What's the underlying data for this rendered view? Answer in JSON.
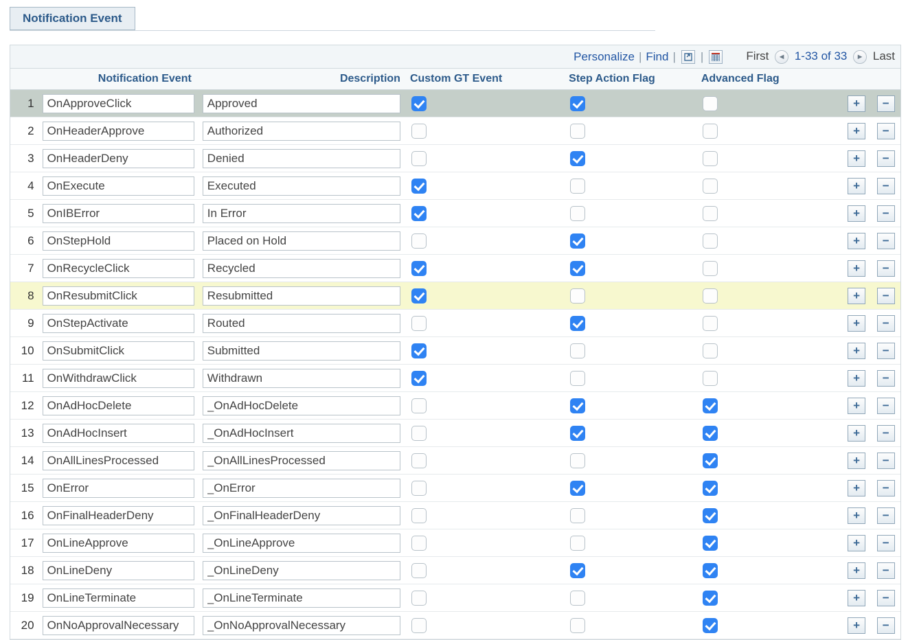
{
  "tab": {
    "label": "Notification Event"
  },
  "toolbar": {
    "personalize": "Personalize",
    "find": "Find",
    "first": "First",
    "last": "Last",
    "range": "1-33 of 33"
  },
  "columns": {
    "event": "Notification Event",
    "description": "Description",
    "custom_gt": "Custom GT Event",
    "step_action": "Step Action Flag",
    "advanced": "Advanced Flag"
  },
  "rows": [
    {
      "n": 1,
      "event": "OnApproveClick",
      "desc": "Approved",
      "cgt": true,
      "saf": true,
      "adv": false,
      "selected": true
    },
    {
      "n": 2,
      "event": "OnHeaderApprove",
      "desc": "Authorized",
      "cgt": false,
      "saf": false,
      "adv": false
    },
    {
      "n": 3,
      "event": "OnHeaderDeny",
      "desc": "Denied",
      "cgt": false,
      "saf": true,
      "adv": false
    },
    {
      "n": 4,
      "event": "OnExecute",
      "desc": "Executed",
      "cgt": true,
      "saf": false,
      "adv": false
    },
    {
      "n": 5,
      "event": "OnIBError",
      "desc": "In Error",
      "cgt": true,
      "saf": false,
      "adv": false
    },
    {
      "n": 6,
      "event": "OnStepHold",
      "desc": "Placed on Hold",
      "cgt": false,
      "saf": true,
      "adv": false
    },
    {
      "n": 7,
      "event": "OnRecycleClick",
      "desc": "Recycled",
      "cgt": true,
      "saf": true,
      "adv": false
    },
    {
      "n": 8,
      "event": "OnResubmitClick",
      "desc": "Resubmitted",
      "cgt": true,
      "saf": false,
      "adv": false,
      "highlight": true
    },
    {
      "n": 9,
      "event": "OnStepActivate",
      "desc": "Routed",
      "cgt": false,
      "saf": true,
      "adv": false
    },
    {
      "n": 10,
      "event": "OnSubmitClick",
      "desc": "Submitted",
      "cgt": true,
      "saf": false,
      "adv": false
    },
    {
      "n": 11,
      "event": "OnWithdrawClick",
      "desc": "Withdrawn",
      "cgt": true,
      "saf": false,
      "adv": false
    },
    {
      "n": 12,
      "event": "OnAdHocDelete",
      "desc": "_OnAdHocDelete",
      "cgt": false,
      "saf": true,
      "adv": true
    },
    {
      "n": 13,
      "event": "OnAdHocInsert",
      "desc": "_OnAdHocInsert",
      "cgt": false,
      "saf": true,
      "adv": true
    },
    {
      "n": 14,
      "event": "OnAllLinesProcessed",
      "desc": "_OnAllLinesProcessed",
      "cgt": false,
      "saf": false,
      "adv": true
    },
    {
      "n": 15,
      "event": "OnError",
      "desc": "_OnError",
      "cgt": false,
      "saf": true,
      "adv": true
    },
    {
      "n": 16,
      "event": "OnFinalHeaderDeny",
      "desc": "_OnFinalHeaderDeny",
      "cgt": false,
      "saf": false,
      "adv": true
    },
    {
      "n": 17,
      "event": "OnLineApprove",
      "desc": "_OnLineApprove",
      "cgt": false,
      "saf": false,
      "adv": true
    },
    {
      "n": 18,
      "event": "OnLineDeny",
      "desc": "_OnLineDeny",
      "cgt": false,
      "saf": true,
      "adv": true
    },
    {
      "n": 19,
      "event": "OnLineTerminate",
      "desc": "_OnLineTerminate",
      "cgt": false,
      "saf": false,
      "adv": true
    },
    {
      "n": 20,
      "event": "OnNoApprovalNecessary",
      "desc": "_OnNoApprovalNecessary",
      "cgt": false,
      "saf": false,
      "adv": true
    }
  ],
  "glyphs": {
    "plus": "+",
    "minus": "−",
    "prev": "◄",
    "next": "►"
  }
}
